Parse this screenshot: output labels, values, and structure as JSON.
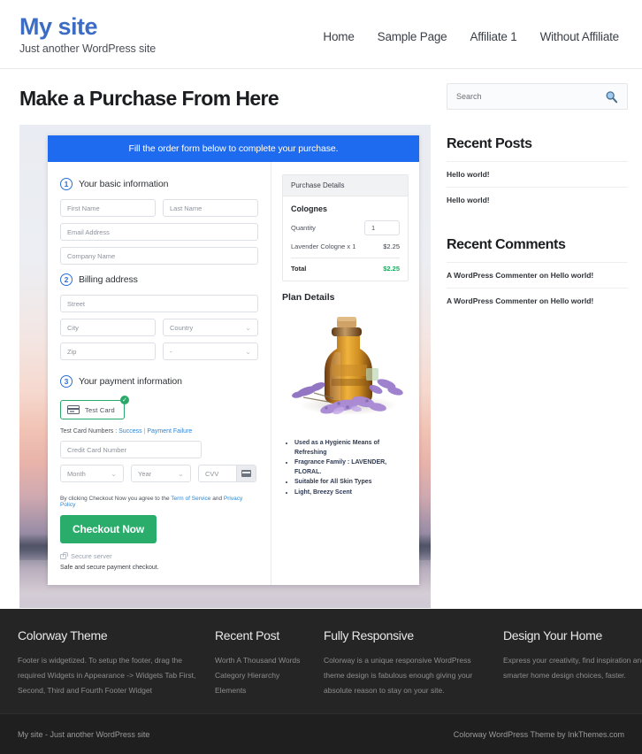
{
  "header": {
    "site_title": "My site",
    "tagline": "Just another WordPress site",
    "nav": [
      {
        "label": "Home"
      },
      {
        "label": "Sample Page"
      },
      {
        "label": "Affiliate 1"
      },
      {
        "label": "Without Affiliate"
      }
    ]
  },
  "main": {
    "page_title": "Make a Purchase From Here",
    "form_banner": "Fill the order form below to complete your purchase.",
    "steps": {
      "one_num": "1",
      "one_label": "Your basic information",
      "two_num": "2",
      "two_label": "Billing address",
      "three_num": "3",
      "three_label": "Your payment information"
    },
    "fields": {
      "first_name": "First Name",
      "last_name": "Last Name",
      "email": "Email Address",
      "company": "Company Name",
      "street": "Street",
      "city": "City",
      "country": "Country",
      "zip": "Zip",
      "state": "-",
      "credit_card": "Credit Card Number",
      "month": "Month",
      "year": "Year",
      "cvv": "CVV"
    },
    "payment": {
      "test_card_label": "Test  Card",
      "test_card_check": "✓",
      "test_numbers_prefix": "Test Card Numbers : ",
      "test_success": "Success",
      "test_separator": " | ",
      "test_failure": "Payment Failure",
      "terms_prefix": "By clicking Checkout Now you agree to the ",
      "terms_link_1": "Term of Service",
      "terms_mid": " and ",
      "terms_link_2": "Privacy Policy",
      "checkout_label": "Checkout Now",
      "secure_server": "Secure server",
      "safe_text": "Safe and secure payment checkout."
    },
    "purchase_details": {
      "head": "Purchase Details",
      "group": "Colognes",
      "quantity_label": "Quantity",
      "quantity_value": "1",
      "line_item_label": "Lavender Cologne x 1",
      "line_item_price": "$2.25",
      "total_label": "Total",
      "total_price": "$2.25"
    },
    "plan": {
      "title": "Plan Details",
      "bullets": [
        "Used as a Hygienic Means of Refreshing",
        "Fragrance Family : LAVENDER, FLORAL.",
        "Suitable for All Skin Types",
        "Light, Breezy Scent"
      ]
    }
  },
  "sidebar": {
    "search_placeholder": "Search",
    "recent_posts_title": "Recent Posts",
    "recent_posts": [
      {
        "label": "Hello world!"
      },
      {
        "label": "Hello world!"
      }
    ],
    "recent_comments_title": "Recent Comments",
    "recent_comments": [
      {
        "label": "A WordPress Commenter on Hello world!"
      },
      {
        "label": "A WordPress Commenter on Hello world!"
      }
    ]
  },
  "footer": {
    "columns": [
      {
        "title": "Colorway Theme",
        "text": "Footer is widgetized. To setup the footer, drag the required Widgets in Appearance -> Widgets Tab First, Second, Third and Fourth Footer Widget"
      },
      {
        "title": "Recent Post",
        "items": [
          {
            "label": "Worth A Thousand Words"
          },
          {
            "label": "Category Hierarchy"
          },
          {
            "label": "Elements"
          }
        ]
      },
      {
        "title": "Fully Responsive",
        "text": "Colorway is a unique responsive WordPress theme design is fabulous enough giving your absolute reason to stay on your site."
      },
      {
        "title": "Design Your Home",
        "text": "Express your creativity, find inspiration and make smarter home design choices, faster."
      }
    ],
    "copyright_left": "My site - Just another WordPress site",
    "copyright_right": "Colorway WordPress Theme by InkThemes.com"
  },
  "colors": {
    "brand_blue": "#3d6cc4",
    "banner_blue": "#1e6bf0",
    "success_green": "#2aac6b",
    "total_green": "#1aa85d",
    "link_blue": "#2a87d8",
    "footer_dark": "#252525"
  }
}
